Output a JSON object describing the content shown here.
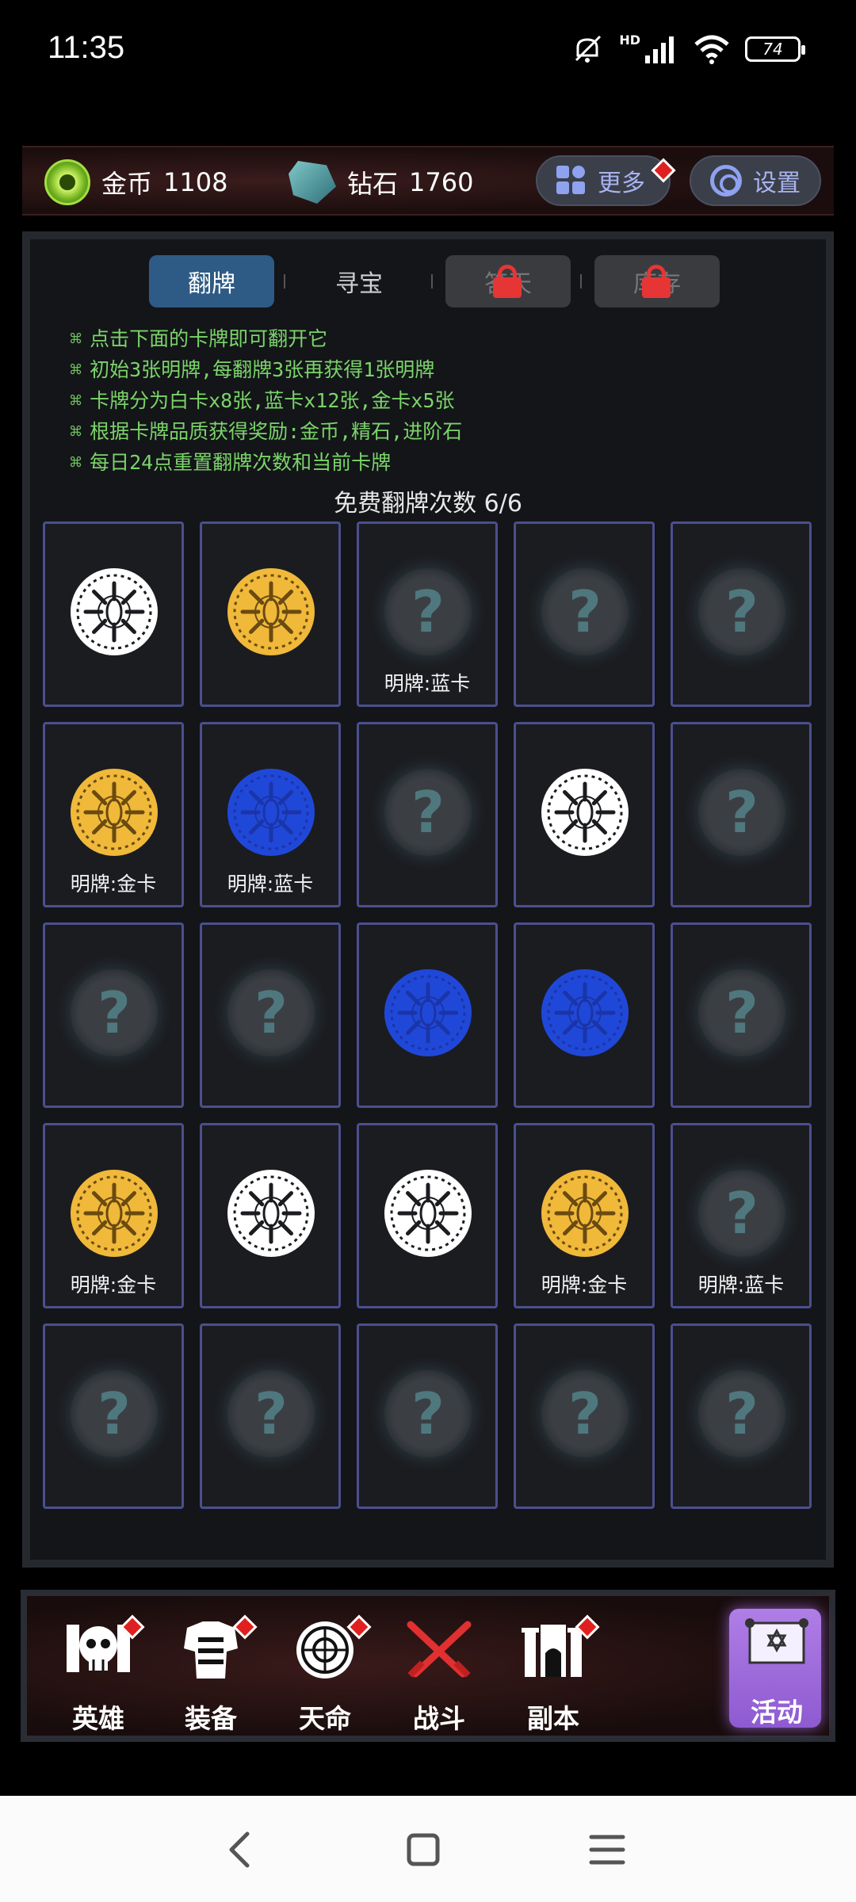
{
  "status_bar": {
    "time": "11:35",
    "network": "HD",
    "battery": "74"
  },
  "resources": {
    "gold": {
      "label": "金币",
      "value": "1108"
    },
    "diamond": {
      "label": "钻石",
      "value": "1760"
    },
    "more_label": "更多",
    "settings_label": "设置"
  },
  "tabs": [
    {
      "label": "翻牌",
      "state": "active"
    },
    {
      "label": "寻宝",
      "state": "normal"
    },
    {
      "label": "答天",
      "state": "locked"
    },
    {
      "label": "库存",
      "state": "locked"
    }
  ],
  "rules": {
    "bullet": "⌘",
    "items": [
      "点击下面的卡牌即可翻开它",
      "初始3张明牌,每翻牌3张再获得1张明牌",
      "卡牌分为白卡x8张,蓝卡x12张,金卡x5张",
      "根据卡牌品质获得奖励:金币,精石,进阶石",
      "每日24点重置翻牌次数和当前卡牌"
    ]
  },
  "free_flips": {
    "label": "免费翻牌次数",
    "value": "6/6"
  },
  "card_colors": {
    "white": "#ffffff",
    "gold": "#f0b93a",
    "blue": "#2048d8"
  },
  "cards": [
    {
      "face": "white",
      "label": ""
    },
    {
      "face": "gold",
      "label": ""
    },
    {
      "face": "hidden",
      "label": "明牌:蓝卡"
    },
    {
      "face": "hidden",
      "label": ""
    },
    {
      "face": "hidden",
      "label": ""
    },
    {
      "face": "gold",
      "label": "明牌:金卡"
    },
    {
      "face": "blue",
      "label": "明牌:蓝卡"
    },
    {
      "face": "hidden",
      "label": ""
    },
    {
      "face": "white",
      "label": ""
    },
    {
      "face": "hidden",
      "label": ""
    },
    {
      "face": "hidden",
      "label": ""
    },
    {
      "face": "hidden",
      "label": ""
    },
    {
      "face": "blue",
      "label": ""
    },
    {
      "face": "blue",
      "label": ""
    },
    {
      "face": "hidden",
      "label": ""
    },
    {
      "face": "gold",
      "label": "明牌:金卡"
    },
    {
      "face": "white",
      "label": ""
    },
    {
      "face": "white",
      "label": ""
    },
    {
      "face": "gold",
      "label": "明牌:金卡"
    },
    {
      "face": "hidden",
      "label": "明牌:蓝卡"
    },
    {
      "face": "hidden",
      "label": ""
    },
    {
      "face": "hidden",
      "label": ""
    },
    {
      "face": "hidden",
      "label": ""
    },
    {
      "face": "hidden",
      "label": ""
    },
    {
      "face": "hidden",
      "label": ""
    }
  ],
  "hidden_mark": "?",
  "bottom_nav": [
    {
      "label": "英雄",
      "icon": "skull-icon",
      "badge": true
    },
    {
      "label": "装备",
      "icon": "armor-icon",
      "badge": true
    },
    {
      "label": "天命",
      "icon": "fate-icon",
      "badge": true
    },
    {
      "label": "战斗",
      "icon": "crossed-swords-icon",
      "badge": false
    },
    {
      "label": "副本",
      "icon": "dungeon-icon",
      "badge": true
    },
    {
      "label": "活动",
      "icon": "event-scroll-icon",
      "badge": false,
      "active": true
    }
  ]
}
